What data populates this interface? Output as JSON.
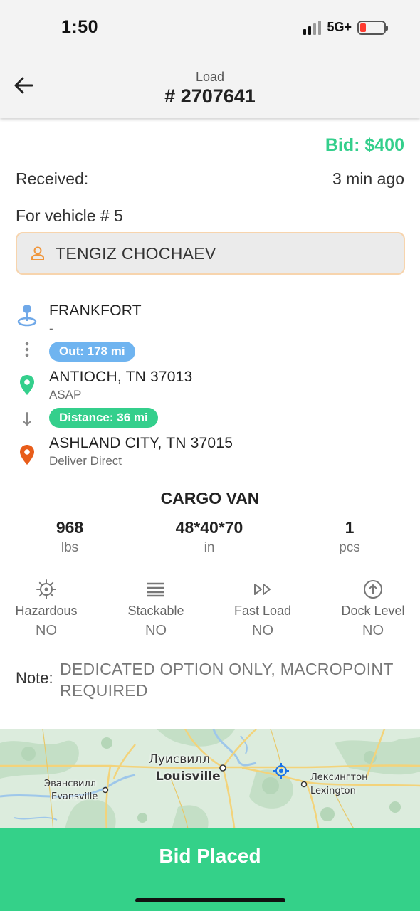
{
  "status_bar": {
    "time": "1:50",
    "network": "5G+"
  },
  "header": {
    "subtitle": "Load",
    "title": "# 2707641",
    "back_icon": "arrow-left-icon"
  },
  "bid": "Bid: $400",
  "received": {
    "label": "Received:",
    "value": "3 min ago"
  },
  "vehicle": "For vehicle # 5",
  "driver": {
    "name": "TENGIZ CHOCHAEV",
    "icon": "person-icon",
    "border_color": "#f7d4ad"
  },
  "route": {
    "origin": {
      "city": "FRANKFORT",
      "detail": "-",
      "icon": "current-location-pin-icon"
    },
    "out_pill": "Out: 178 mi",
    "pickup": {
      "city": "ANTIOCH, TN 37013",
      "detail": "ASAP",
      "icon": "green-location-pin-icon"
    },
    "distance_pill": "Distance: 36 mi",
    "delivery": {
      "city": "ASHLAND CITY, TN 37015",
      "detail": "Deliver Direct",
      "icon": "orange-location-pin-icon"
    }
  },
  "cargo": {
    "title": "CARGO VAN",
    "stats": [
      {
        "value": "968",
        "unit": "lbs"
      },
      {
        "value": "48*40*70",
        "unit": "in"
      },
      {
        "value": "1",
        "unit": "pcs"
      }
    ],
    "features": [
      {
        "label": "Hazardous",
        "value": "NO",
        "icon": "hazard-icon"
      },
      {
        "label": "Stackable",
        "value": "NO",
        "icon": "stack-icon"
      },
      {
        "label": "Fast Load",
        "value": "NO",
        "icon": "fast-forward-icon"
      },
      {
        "label": "Dock Level",
        "value": "NO",
        "icon": "arrow-up-circle-icon"
      }
    ]
  },
  "note": {
    "label": "Note:",
    "text": "DEDICATED OPTION ONLY, MACROPOINT REQUIRED"
  },
  "map": {
    "labels": {
      "louisville_ru": "Луисвилл",
      "louisville": "Louisville",
      "evansville_ru": "Эвансвилл",
      "evansville": "Evansville",
      "lexington_ru": "Лексингтон",
      "lexington": "Lexington"
    }
  },
  "bottom_button": "Bid Placed",
  "colors": {
    "accent_green": "#34cf8c",
    "pill_blue": "#6fb4f0",
    "pin_orange": "#e85d1a",
    "bar_green": "#34d189"
  }
}
